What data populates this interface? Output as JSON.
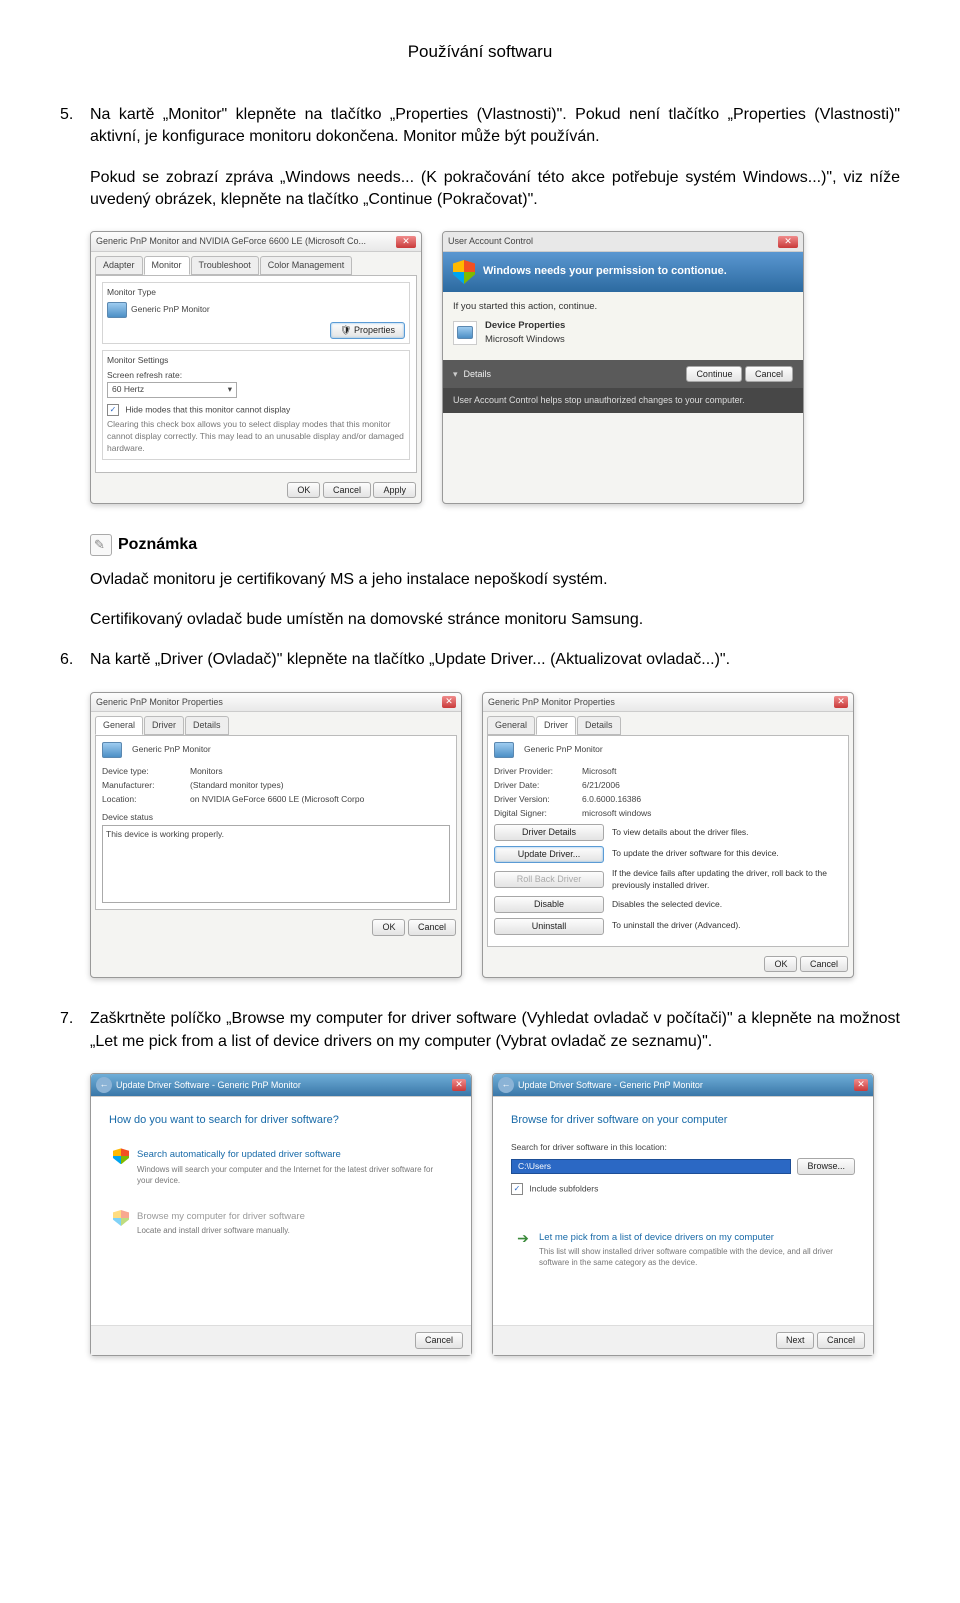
{
  "header": "Používání softwaru",
  "step5": {
    "num": "5.",
    "text": "Na kartě „Monitor\" klepněte na tlačítko „Properties (Vlastnosti)\". Pokud není tlačítko „Properties (Vlastnosti)\" aktivní, je konfigurace monitoru dokončena. Monitor může být používán.",
    "para": "Pokud se zobrazí zpráva „Windows needs... (K pokračování této akce potřebuje systém Windows...)\", viz níže uvedený obrázek, klepněte na tlačítko „Continue (Pokračovat)\"."
  },
  "dlgA": {
    "title": "Generic PnP Monitor and NVIDIA GeForce 6600 LE (Microsoft Co...",
    "tabs": {
      "adapter": "Adapter",
      "monitor": "Monitor",
      "troubleshoot": "Troubleshoot",
      "color": "Color Management"
    },
    "group_type": "Monitor Type",
    "monitor_name": "Generic PnP Monitor",
    "btn_properties": "Properties",
    "group_settings": "Monitor Settings",
    "label_refresh": "Screen refresh rate:",
    "refresh_value": "60 Hertz",
    "chk_hide": "Hide modes that this monitor cannot display",
    "hide_desc": "Clearing this check box allows you to select display modes that this monitor cannot display correctly. This may lead to an unusable display and/or damaged hardware.",
    "ok": "OK",
    "cancel": "Cancel",
    "apply": "Apply"
  },
  "uac": {
    "title": "User Account Control",
    "headline": "Windows needs your permission to contionue.",
    "started": "If you started this action, continue.",
    "prog1": "Device Properties",
    "prog2": "Microsoft Windows",
    "details": "Details",
    "continue": "Continue",
    "cancel": "Cancel",
    "foot": "User Account Control helps stop unauthorized changes to your computer."
  },
  "note": {
    "label": "Poznámka",
    "p1": "Ovladač monitoru je certifikovaný MS a jeho instalace nepoškodí systém.",
    "p2": "Certifikovaný ovladač bude umístěn na domovské stránce monitoru Samsung."
  },
  "step6": {
    "num": "6.",
    "text": "Na kartě „Driver (Ovladač)\" klepněte na tlačítko „Update Driver... (Aktualizovat ovladač...)\"."
  },
  "propL": {
    "title": "Generic PnP Monitor Properties",
    "tabs": {
      "general": "General",
      "driver": "Driver",
      "details": "Details"
    },
    "name": "Generic PnP Monitor",
    "k_devtype": "Device type:",
    "v_devtype": "Monitors",
    "k_manu": "Manufacturer:",
    "v_manu": "(Standard monitor types)",
    "k_loc": "Location:",
    "v_loc": "on NVIDIA GeForce 6600 LE (Microsoft Corpo",
    "grp_status": "Device status",
    "status": "This device is working properly.",
    "ok": "OK",
    "cancel": "Cancel"
  },
  "propR": {
    "title": "Generic PnP Monitor Properties",
    "tabs": {
      "general": "General",
      "driver": "Driver",
      "details": "Details"
    },
    "name": "Generic PnP Monitor",
    "k_prov": "Driver Provider:",
    "v_prov": "Microsoft",
    "k_date": "Driver Date:",
    "v_date": "6/21/2006",
    "k_ver": "Driver Version:",
    "v_ver": "6.0.6000.16386",
    "k_sign": "Digital Signer:",
    "v_sign": "microsoft windows",
    "b_det": "Driver Details",
    "d_det": "To view details about the driver files.",
    "b_upd": "Update Driver...",
    "d_upd": "To update the driver software for this device.",
    "b_roll": "Roll Back Driver",
    "d_roll": "If the device fails after updating the driver, roll back to the previously installed driver.",
    "b_dis": "Disable",
    "d_dis": "Disables the selected device.",
    "b_uni": "Uninstall",
    "d_uni": "To uninstall the driver (Advanced).",
    "ok": "OK",
    "cancel": "Cancel"
  },
  "step7": {
    "num": "7.",
    "text": "Zaškrtněte políčko „Browse my computer for driver software (Vyhledat ovladač v počítači)\" a klepněte na možnost „Let me pick from a list of device drivers on my computer (Vybrat ovladač ze seznamu)\"."
  },
  "wizL": {
    "title": "Update Driver Software - Generic PnP Monitor",
    "q": "How do you want to search for driver software?",
    "o1t": "Search automatically for updated driver software",
    "o1d": "Windows will search your computer and the Internet for the latest driver software for your device.",
    "o2t": "Browse my computer for driver software",
    "o2d": "Locate and install driver software manually.",
    "cancel": "Cancel"
  },
  "wizR": {
    "title": "Update Driver Software - Generic PnP Monitor",
    "q": "Browse for driver software on your computer",
    "label_loc": "Search for driver software in this location:",
    "path": "C:\\Users",
    "browse": "Browse...",
    "chk_sub": "Include subfolders",
    "o1t": "Let me pick from a list of device drivers on my computer",
    "o1d": "This list will show installed driver software compatible with the device, and all driver software in the same category as the device.",
    "next": "Next",
    "cancel": "Cancel"
  }
}
